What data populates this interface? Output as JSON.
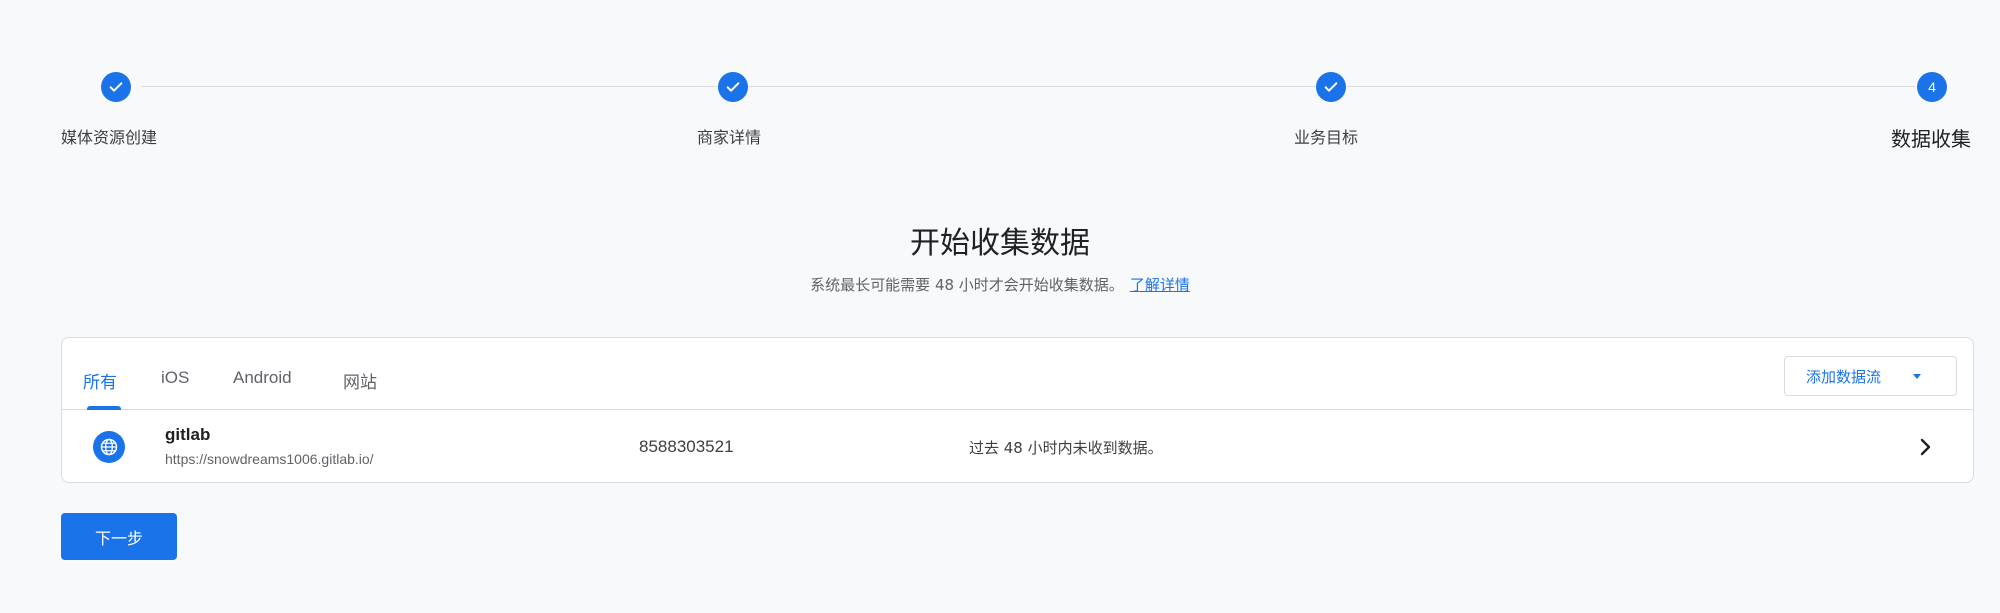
{
  "stepper": {
    "steps": [
      {
        "label": "媒体资源创建",
        "state": "done",
        "icon": "check-icon"
      },
      {
        "label": "商家详情",
        "state": "done",
        "icon": "check-icon"
      },
      {
        "label": "业务目标",
        "state": "done",
        "icon": "check-icon"
      },
      {
        "label": "数据收集",
        "state": "active",
        "number": "4"
      }
    ]
  },
  "main": {
    "title": "开始收集数据",
    "subtitle": "系统最长可能需要 48 小时才会开始收集数据。",
    "learn_more": "了解详情"
  },
  "card": {
    "tabs": [
      {
        "label": "所有",
        "active": true
      },
      {
        "label": "iOS",
        "active": false
      },
      {
        "label": "Android",
        "active": false
      },
      {
        "label": "网站",
        "active": false
      }
    ],
    "add_stream_label": "添加数据流",
    "streams": [
      {
        "icon": "globe-icon",
        "name": "gitlab",
        "url": "https://snowdreams1006.gitlab.io/",
        "stream_id": "8588303521",
        "status": "过去 48 小时内未收到数据。"
      }
    ]
  },
  "footer": {
    "next_label": "下一步"
  },
  "colors": {
    "accent": "#1a73e8",
    "background": "#f8f9fa",
    "border": "#dadce0"
  }
}
